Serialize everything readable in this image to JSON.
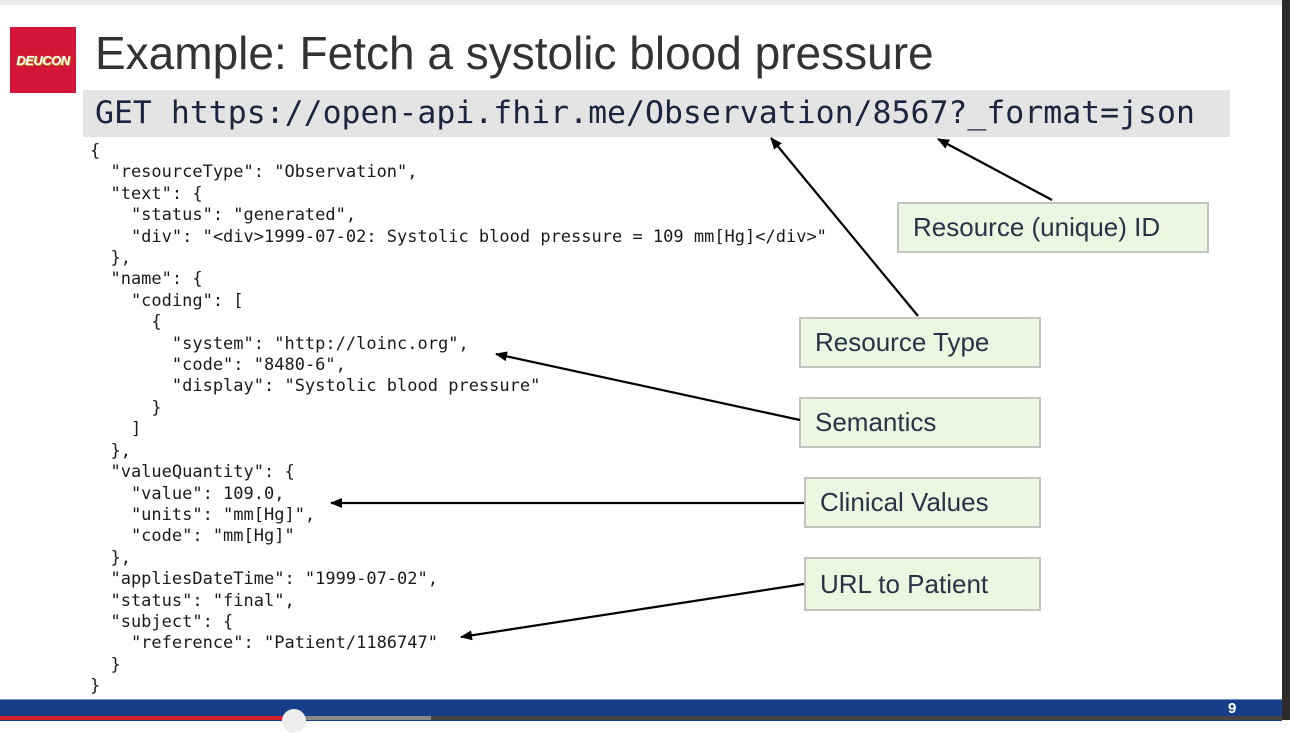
{
  "logo": {
    "text": "DEUCON",
    "color": "#d4153a"
  },
  "slide": {
    "title": "Example: Fetch a systolic blood pressure",
    "request": "GET https://open-api.fhir.me/Observation/8567?_format=json",
    "code_lines": [
      "{",
      "  \"resourceType\": \"Observation\",",
      "  \"text\": {",
      "    \"status\": \"generated\",",
      "    \"div\": \"<div>1999-07-02: Systolic blood pressure = 109 mm[Hg]</div>\"",
      "  },",
      "  \"name\": {",
      "    \"coding\": [",
      "      {",
      "        \"system\": \"http://loinc.org\",",
      "        \"code\": \"8480-6\",",
      "        \"display\": \"Systolic blood pressure\"",
      "      }",
      "    ]",
      "  },",
      "  \"valueQuantity\": {",
      "    \"value\": 109.0,",
      "    \"units\": \"mm[Hg]\",",
      "    \"code\": \"mm[Hg]\"",
      "  },",
      "  \"appliesDateTime\": \"1999-07-02\",",
      "  \"status\": \"final\",",
      "  \"subject\": {",
      "    \"reference\": \"Patient/1186747\"",
      "  }",
      "}"
    ],
    "callouts": {
      "resource_id": "Resource (unique) ID",
      "resource_type": "Resource Type",
      "semantics": "Semantics",
      "clinical_values": "Clinical Values",
      "url_to_patient": "URL to Patient"
    },
    "page_number": "9"
  },
  "player": {
    "progress_percent": 22.6,
    "buffered_percent": 33.6,
    "progress_color": "#d52027"
  },
  "colors": {
    "footer": "#163f87",
    "callout_bg": "#ebf7e1",
    "callout_text": "#263447"
  }
}
